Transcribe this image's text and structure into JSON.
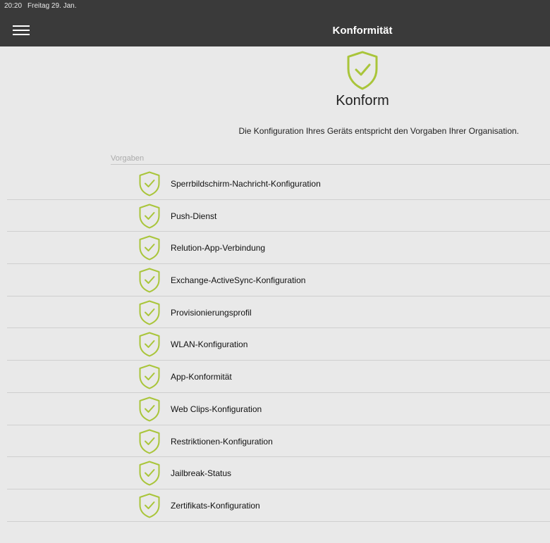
{
  "status_bar": {
    "time": "20:20",
    "date": "Freitag 29. Jan."
  },
  "header": {
    "title": "Konformität",
    "menu_icon": "hamburger-menu-icon"
  },
  "hero": {
    "icon": "shield-check-icon",
    "title": "Konform",
    "description": "Die Konfiguration Ihres Geräts entspricht den Vorgaben Ihrer Organisation."
  },
  "section": {
    "label": "Vorgaben"
  },
  "items": [
    {
      "label": "Sperrbildschirm-Nachricht-Konfiguration",
      "icon": "shield-check-icon"
    },
    {
      "label": "Push-Dienst",
      "icon": "shield-check-icon"
    },
    {
      "label": "Relution-App-Verbindung",
      "icon": "shield-check-icon"
    },
    {
      "label": "Exchange-ActiveSync-Konfiguration",
      "icon": "shield-check-icon"
    },
    {
      "label": "Provisionierungsprofil",
      "icon": "shield-check-icon"
    },
    {
      "label": "WLAN-Konfiguration",
      "icon": "shield-check-icon"
    },
    {
      "label": "App-Konformität",
      "icon": "shield-check-icon"
    },
    {
      "label": "Web Clips-Konfiguration",
      "icon": "shield-check-icon"
    },
    {
      "label": "Restriktionen-Konfiguration",
      "icon": "shield-check-icon"
    },
    {
      "label": "Jailbreak-Status",
      "icon": "shield-check-icon"
    },
    {
      "label": "Zertifikats-Konfiguration",
      "icon": "shield-check-icon"
    }
  ],
  "colors": {
    "header_bg": "#3a3a3a",
    "page_bg": "#e9e9e9",
    "accent": "#a9c53a"
  }
}
